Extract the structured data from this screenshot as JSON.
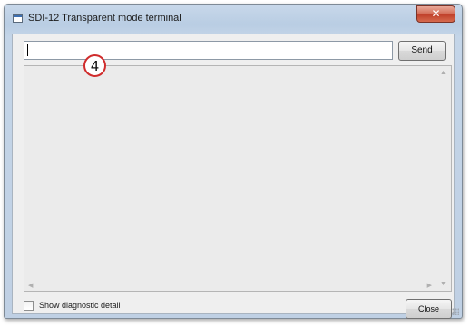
{
  "window": {
    "title": "SDI-12 Transparent mode terminal",
    "close_glyph": "✕"
  },
  "command": {
    "value": "",
    "send_label": "Send"
  },
  "output": {
    "text": ""
  },
  "footer": {
    "diagnostic_label": "Show diagnostic detail",
    "diagnostic_checked": false,
    "close_label": "Close"
  },
  "annotation": {
    "callout_number": "4",
    "callout_color": "#d02c2c"
  },
  "icons": {
    "app": "terminal-window-icon",
    "scroll_up": "scroll-up-arrow-icon",
    "scroll_down": "scroll-down-arrow-icon"
  }
}
